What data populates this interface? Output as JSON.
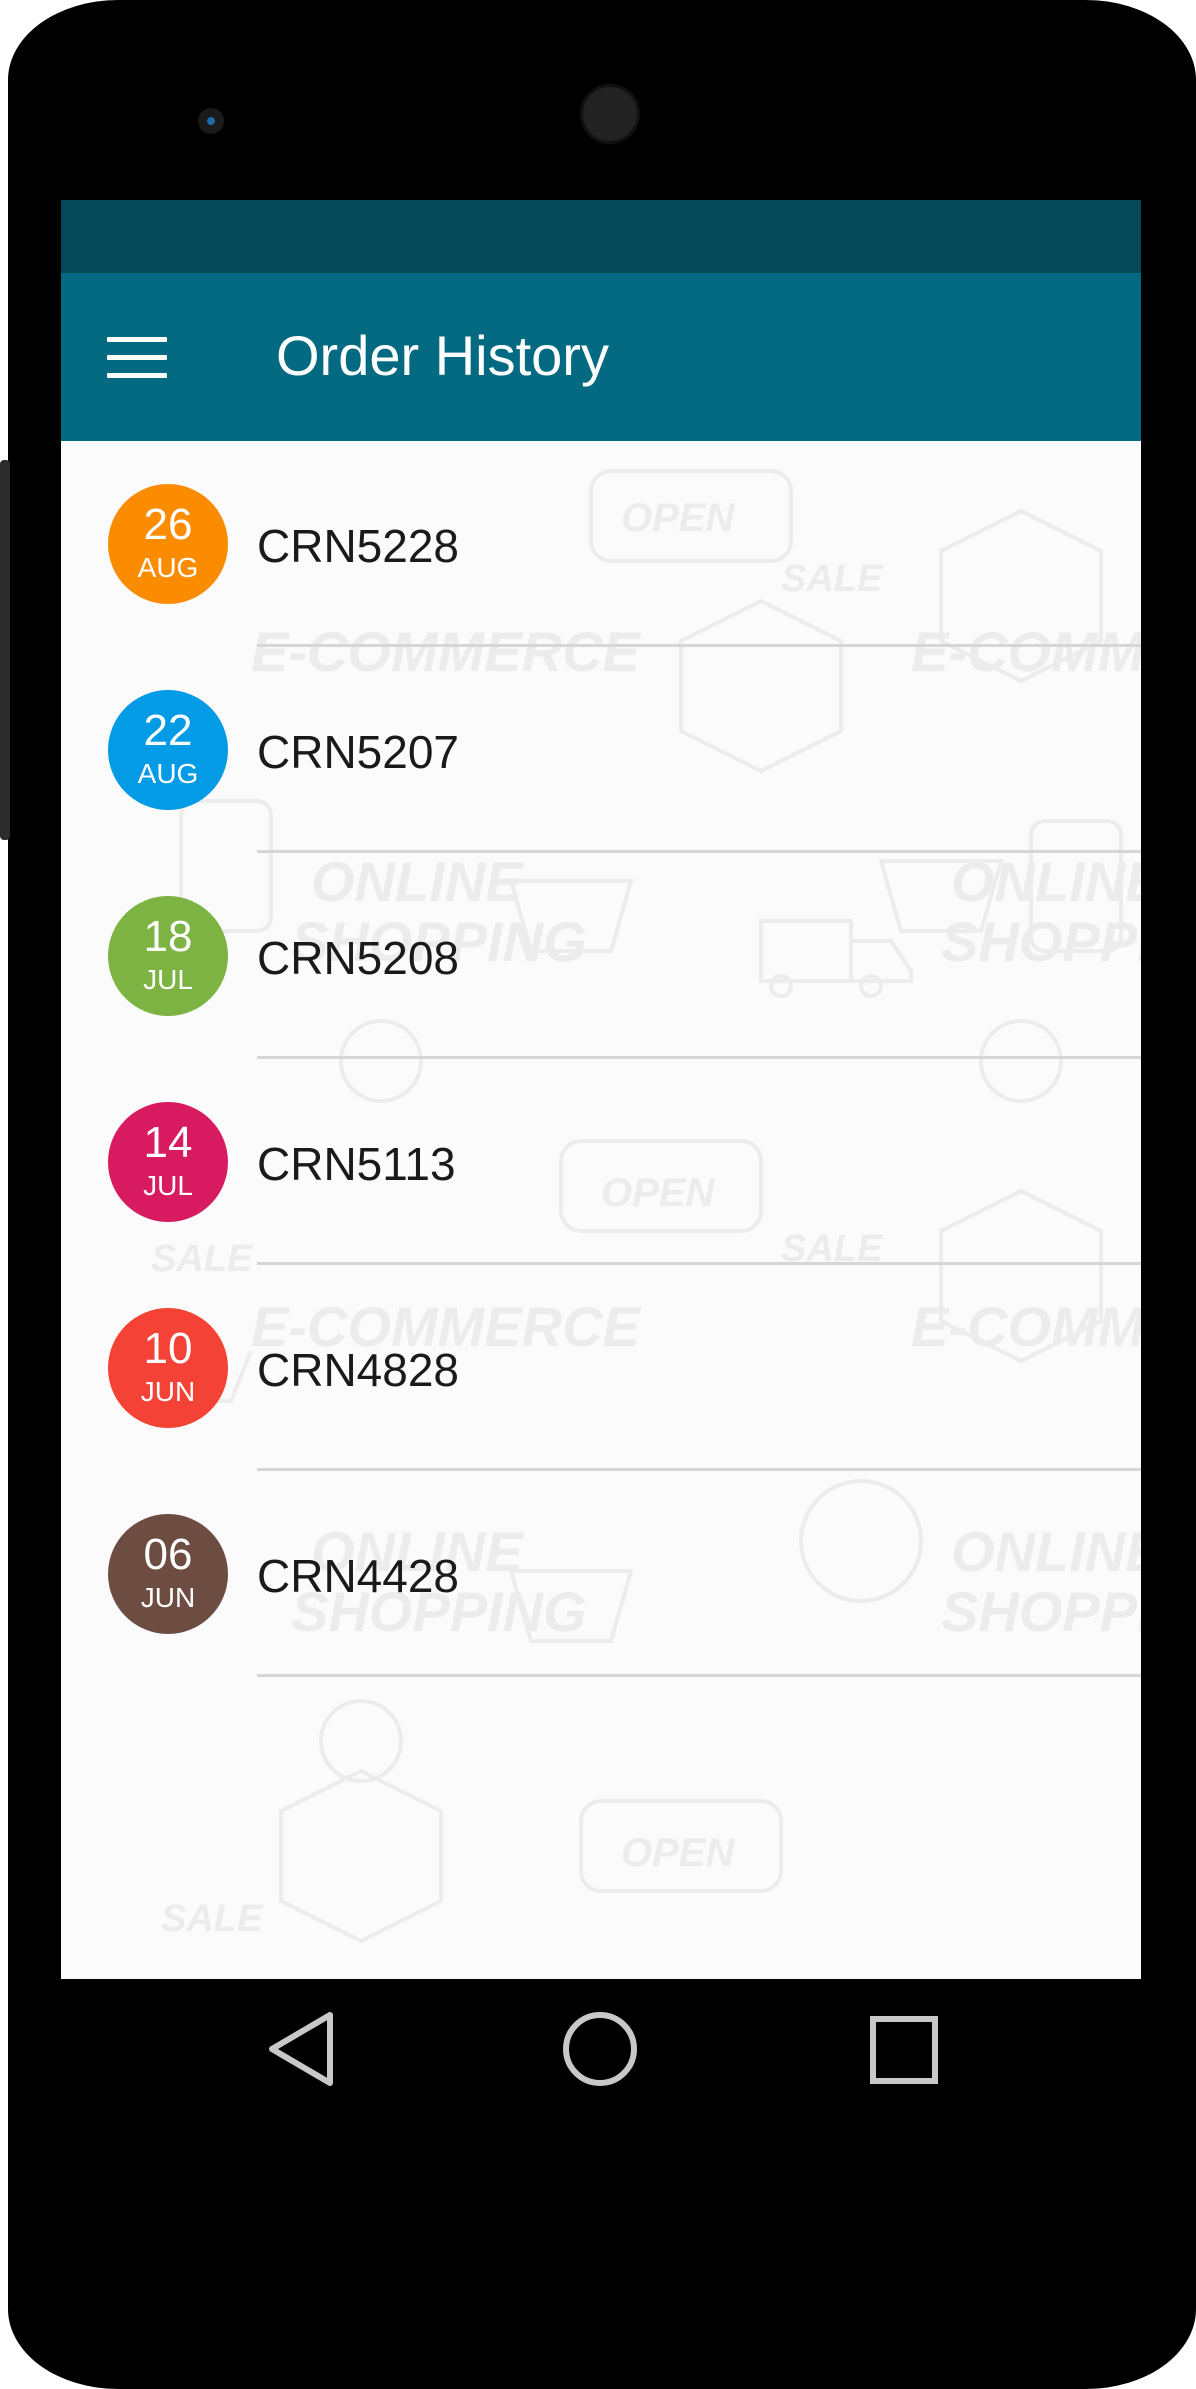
{
  "app_bar": {
    "title": "Order History",
    "menu_icon": "hamburger-menu-icon"
  },
  "orders": [
    {
      "day": "26",
      "month": "AUG",
      "id": "CRN5228",
      "color": "#fb8c00"
    },
    {
      "day": "22",
      "month": "AUG",
      "id": "CRN5207",
      "color": "#039be5"
    },
    {
      "day": "18",
      "month": "JUL",
      "id": "CRN5208",
      "color": "#7cb342"
    },
    {
      "day": "14",
      "month": "JUL",
      "id": "CRN5113",
      "color": "#d81b60"
    },
    {
      "day": "10",
      "month": "JUN",
      "id": "CRN4828",
      "color": "#f44336"
    },
    {
      "day": "06",
      "month": "JUN",
      "id": "CRN4428",
      "color": "#6d4c41"
    }
  ],
  "background_pattern_text": [
    "OPEN",
    "SALE",
    "E-COMMERCE",
    "ONLINE",
    "SHOPPING"
  ],
  "navigation": {
    "back_icon": "back-triangle-icon",
    "home_icon": "home-circle-icon",
    "recents_icon": "recents-square-icon"
  },
  "colors": {
    "status_bar": "#044859",
    "app_bar": "#046a82",
    "screen_background": "#fbfbfb"
  }
}
